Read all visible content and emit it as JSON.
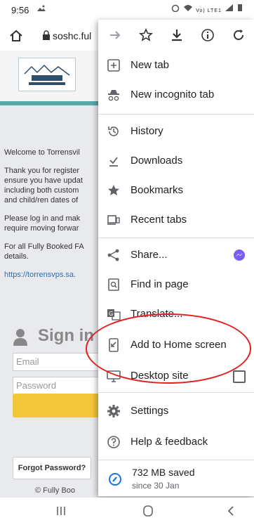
{
  "status": {
    "time": "9:56",
    "signal": "Vo) LTE1"
  },
  "browser": {
    "url": "soshc.ful"
  },
  "page": {
    "logo_text": "TPS OSHC",
    "lines": [
      "Welcome to Torrensvil",
      "Thank you for register",
      "ensure you have updat",
      "including both custom",
      "and child/ren dates of",
      "Please log in and mak",
      "require moving forwar",
      "For all Fully Booked FA",
      "details."
    ],
    "link": "https://torrensvps.sa.",
    "signin": "Sign in",
    "email_placeholder": "Email",
    "password_placeholder": "Password",
    "forgot": "Forgot Password?",
    "footer": "© Fully Boo"
  },
  "menu": {
    "items": [
      {
        "label": "New tab",
        "icon": "plus-box-icon"
      },
      {
        "label": "New incognito tab",
        "icon": "incognito-icon"
      },
      {
        "label": "History",
        "icon": "history-icon"
      },
      {
        "label": "Downloads",
        "icon": "download-done-icon"
      },
      {
        "label": "Bookmarks",
        "icon": "star-filled-icon"
      },
      {
        "label": "Recent tabs",
        "icon": "recent-tabs-icon"
      },
      {
        "label": "Share...",
        "icon": "share-icon"
      },
      {
        "label": "Find in page",
        "icon": "find-in-page-icon"
      },
      {
        "label": "Translate...",
        "icon": "translate-icon"
      },
      {
        "label": "Add to Home screen",
        "icon": "add-to-home-icon"
      },
      {
        "label": "Desktop site",
        "icon": "desktop-icon"
      },
      {
        "label": "Settings",
        "icon": "gear-icon"
      },
      {
        "label": "Help & feedback",
        "icon": "help-icon"
      }
    ],
    "saved": {
      "main": "732 MB saved",
      "sub": "since 30 Jan"
    }
  },
  "colors": {
    "highlight": "#e02020",
    "accent_teal": "#5aa8a8",
    "signin_button": "#f2c73a"
  }
}
